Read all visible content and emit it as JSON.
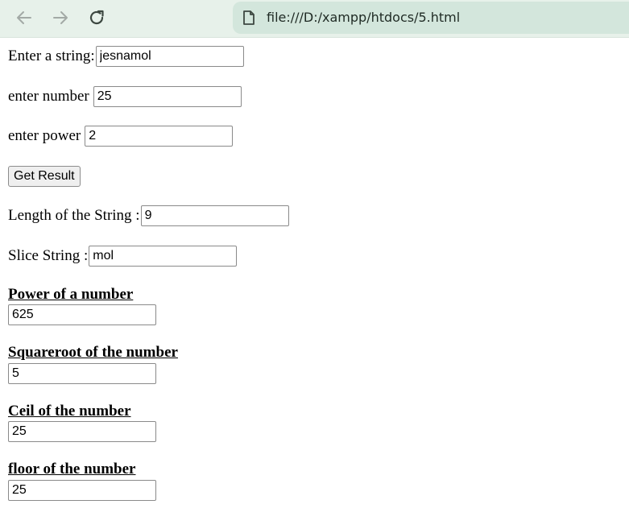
{
  "browser": {
    "back_icon": "arrow-left-icon",
    "forward_icon": "arrow-right-icon",
    "reload_icon": "reload-icon",
    "page_icon": "file-page-icon",
    "url": "file:///D:/xampp/htdocs/5.html"
  },
  "form": {
    "string_label": "Enter a string:",
    "string_value": "jesnamol",
    "number_label": "enter number",
    "number_value": "25",
    "power_label": "enter power",
    "power_value": "2",
    "get_result_label": "Get Result",
    "length_label": "Length of the String :",
    "length_value": "9",
    "slice_label": "Slice String :",
    "slice_value": "mol"
  },
  "results": {
    "power_heading": "Power of a number",
    "power_value": "625",
    "sqrt_heading": "Squareroot of the number",
    "sqrt_value": "5",
    "ceil_heading": "Ceil of the number",
    "ceil_value": "25",
    "floor_heading": "floor of the number",
    "floor_value": "25"
  }
}
